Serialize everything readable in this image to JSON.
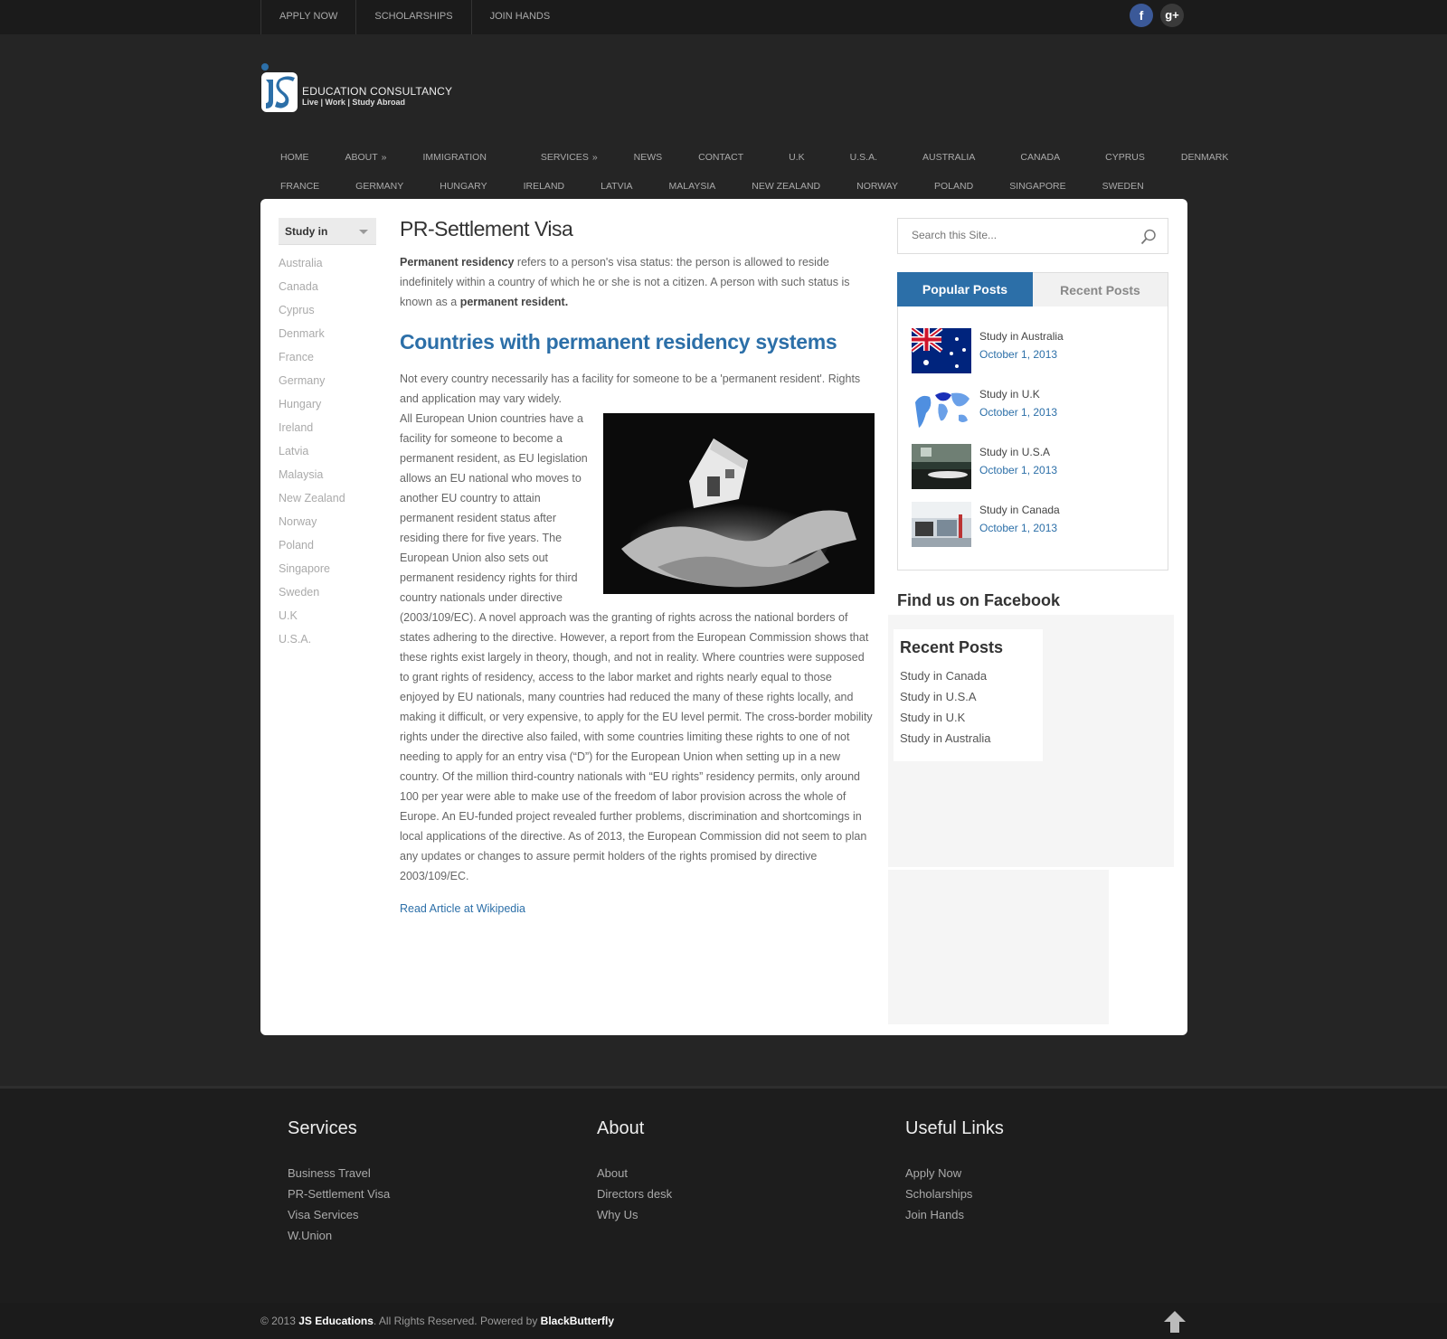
{
  "topnav": [
    "APPLY NOW",
    "SCHOLARSHIPS",
    "JOIN HANDS"
  ],
  "social": {
    "facebook": "f",
    "googleplus": "g+"
  },
  "logo": {
    "title": "EDUCATION CONSULTANCY",
    "tagline": "Live | Work | Study Abroad"
  },
  "mainnav": {
    "row1": [
      "HOME",
      "ABOUT",
      "IMMIGRATION",
      "SERVICES",
      "NEWS",
      "CONTACT",
      "U.K",
      "U.S.A.",
      "AUSTRALIA",
      "CANADA",
      "CYPRUS",
      "DENMARK"
    ],
    "row2": [
      "FRANCE",
      "GERMANY",
      "HUNGARY",
      "IRELAND",
      "LATVIA",
      "MALAYSIA",
      "NEW ZEALAND",
      "NORWAY",
      "POLAND",
      "SINGAPORE",
      "SWEDEN"
    ],
    "submenu_marker": "»"
  },
  "sidebar": {
    "dropdown_label": "Study in",
    "countries": [
      "Australia",
      "Canada",
      "Cyprus",
      "Denmark",
      "France",
      "Germany",
      "Hungary",
      "Ireland",
      "Latvia",
      "Malaysia",
      "New Zealand",
      "Norway",
      "Poland",
      "Singapore",
      "Sweden",
      "U.K",
      "U.S.A."
    ]
  },
  "article": {
    "title": "PR-Settlement Visa",
    "intro_bold1": "Permanent residency",
    "intro_text": " refers to a person's visa status: the person is allowed to reside indefinitely within a country of which he or she is not a citizen. A person with such status is known as a ",
    "intro_bold2": "permanent resident.",
    "heading": "Countries with permanent residency systems",
    "para1": "Not every country necessarily has a facility for someone to be a 'permanent resident'. Rights and application may vary widely.",
    "para2": "All European Union countries have a facility for someone to become a permanent resident, as EU legislation allows an EU national who moves to another EU country to attain permanent resident status after residing there for five years. The European Union also sets out permanent residency rights for third country nationals under directive (2003/109/EC). A novel approach was the granting of rights across the national borders of states adhering to the directive. However, a report from the European Commission shows that these rights exist largely in theory, though, and not in reality. Where countries were supposed to grant rights of residency, access to the labor market and rights nearly equal to those enjoyed by EU nationals, many countries had reduced the many of these rights locally, and making it difficult, or very expensive, to apply for the EU level permit. The cross-border mobility rights under the directive also failed, with some countries limiting these rights to one of not needing to apply for an entry visa (“D”) for the European Union when setting up in a new country. Of the million third-country nationals with “EU rights” residency permits, only around 100 per year were able to make use of the freedom of labor provision across the whole of Europe. An EU-funded project revealed further problems, discrimination and shortcomings in local applications of the directive. As of 2013, the European Commission did not seem to plan any updates or changes to assure permit holders of the rights promised by directive 2003/109/EC.",
    "read_more": "Read Article at Wikipedia"
  },
  "search": {
    "placeholder": "Search this Site..."
  },
  "tabs": {
    "popular": "Popular Posts",
    "recent": "Recent Posts"
  },
  "popular_posts": [
    {
      "title": "Study in Australia",
      "date": "October 1, 2013"
    },
    {
      "title": "Study in U.K",
      "date": "October 1, 2013"
    },
    {
      "title": "Study in U.S.A",
      "date": "October 1, 2013"
    },
    {
      "title": "Study in Canada",
      "date": "October 1, 2013"
    }
  ],
  "facebook": {
    "heading": "Find us on Facebook"
  },
  "recent_widget": {
    "heading": "Recent Posts",
    "items": [
      "Study in Canada",
      "Study in U.S.A",
      "Study in U.K",
      "Study in Australia"
    ]
  },
  "footer": {
    "services": {
      "heading": "Services",
      "items": [
        "Business Travel",
        "PR-Settlement Visa",
        "Visa Services",
        "W.Union"
      ]
    },
    "about": {
      "heading": "About",
      "items": [
        "About",
        "Directors desk",
        "Why Us"
      ]
    },
    "links": {
      "heading": "Useful Links",
      "items": [
        "Apply Now",
        "Scholarships",
        "Join Hands"
      ]
    }
  },
  "copyright": {
    "prefix": "© 2013 ",
    "brand": "JS Educations",
    "middle": ". All Rights Reserved. Powered by ",
    "powered": "BlackButterfly"
  },
  "colors": {
    "accent": "#2c6fa8",
    "background": "#252525",
    "topbar": "#1b1b1b"
  }
}
